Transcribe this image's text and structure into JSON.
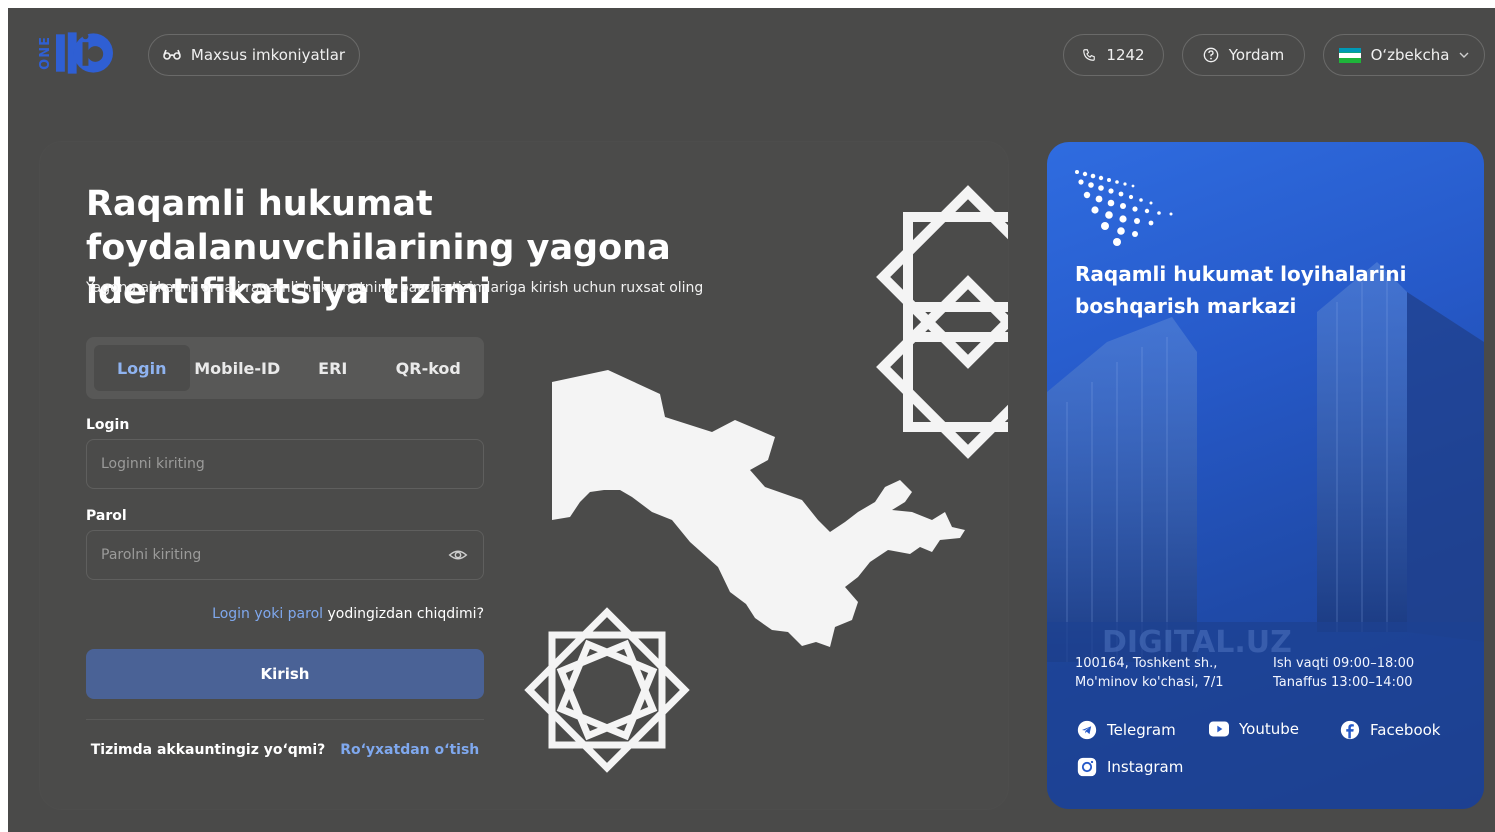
{
  "header": {
    "logo_text": "ONE",
    "logo_mark": "iD",
    "accessibility_label": "Maxsus imkoniyatlar",
    "phone_label": "1242",
    "help_label": "Yordam",
    "language_label": "O‘zbekcha"
  },
  "main": {
    "title": "Raqamli hukumat foydalanuvchilarining yagona identifikatsiya tizimi",
    "subtitle": "Yagona akkaunt orqali raqamli hukumatning barcha tizimlariga kirish uchun ruxsat oling",
    "tabs": [
      {
        "label": "Login",
        "active": true
      },
      {
        "label": "Mobile-ID",
        "active": false
      },
      {
        "label": "ERI",
        "active": false
      },
      {
        "label": "QR-kod",
        "active": false
      }
    ],
    "login_label": "Login",
    "login_placeholder": "Loginni kiriting",
    "password_label": "Parol",
    "password_placeholder": "Parolni kiriting",
    "forgot_link": "Login yoki parol",
    "forgot_text": "yodingizdan chiqdimi?",
    "submit_label": "Kirish",
    "register_question": "Tizimda akkauntingiz yo‘qmi?",
    "register_link": "Ro‘yxatdan o‘tish"
  },
  "side_panel": {
    "title": "Raqamli hukumat loyihalarini boshqarish markazi",
    "address_line1": "100164, Toshkent sh.,",
    "address_line2": "Mo'minov ko'chasi, 7/1",
    "hours_line1": "Ish vaqti 09:00–18:00",
    "hours_line2": "Tanaffus 13:00–14:00",
    "building_sign": "DIGITAL.UZ",
    "socials": [
      {
        "label": "Telegram",
        "icon": "telegram-icon"
      },
      {
        "label": "Youtube",
        "icon": "youtube-icon"
      },
      {
        "label": "Facebook",
        "icon": "facebook-icon"
      },
      {
        "label": "Instagram",
        "icon": "instagram-icon"
      }
    ]
  },
  "colors": {
    "background": "#4a4a49",
    "accent_link": "#7fa8ee",
    "button": "#4a6296",
    "panel_blue": "#2659c8",
    "logo_blue": "#2f5fd3"
  }
}
